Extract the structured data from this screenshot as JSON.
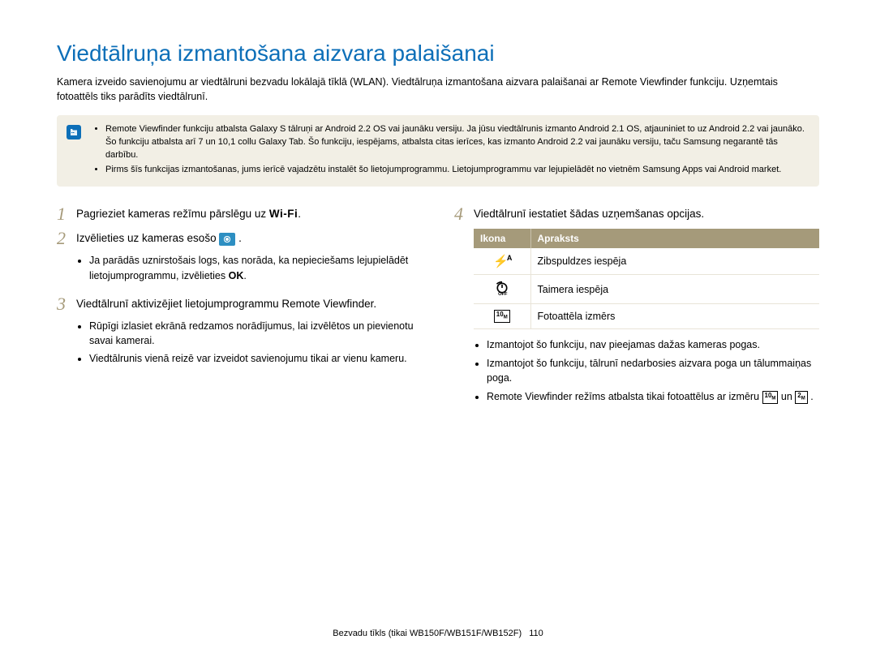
{
  "title": "Viedtālruņa izmantošana aizvara palaišanai",
  "intro": "Kamera izveido savienojumu ar viedtālruni bezvadu lokālajā tīklā (WLAN). Viedtālruņa izmantošana aizvara palaišanai ar Remote Viewfinder funkciju. Uzņemtais fotoattēls tiks parādīts viedtālrunī.",
  "note": {
    "bullet1": "Remote Viewfinder funkciju atbalsta Galaxy S tālruņi ar Android 2.2 OS vai jaunāku versiju. Ja jūsu viedtālrunis izmanto Android 2.1 OS, atjauniniet to uz Android 2.2 vai jaunāko. Šo funkciju atbalsta arī 7 un 10,1 collu Galaxy Tab. Šo funkciju, iespējams, atbalsta citas ierīces, kas izmanto Android 2.2 vai jaunāku versiju, taču Samsung negarantē tās darbību.",
    "bullet2": "Pirms šīs funkcijas izmantošanas, jums ierīcē vajadzētu instalēt šo lietojumprogrammu. Lietojumprogrammu var lejupielādēt no vietnēm Samsung Apps vai Android market."
  },
  "steps": {
    "s1": "Pagrieziet kameras režīmu pārslēgu uz ",
    "s1_wifi": "Wi-Fi",
    "s1_end": ".",
    "s2": "Izvēlieties uz kameras esošo ",
    "s2_end": " .",
    "s2_sub1_a": "Ja parādās uznirstošais logs, kas norāda, ka nepieciešams lejupielādēt lietojumprogrammu, izvēlieties ",
    "s2_sub1_ok": "OK",
    "s2_sub1_b": ".",
    "s3": "Viedtālrunī aktivizējiet lietojumprogrammu Remote Viewfinder.",
    "s3_sub1": "Rūpīgi izlasiet ekrānā redzamos norādījumus, lai izvēlētos un pievienotu savai kamerai.",
    "s3_sub2": "Viedtālrunis vienā reizē var izveidot savienojumu tikai ar vienu kameru.",
    "s4": "Viedtālrunī iestatiet šādas uzņemšanas opcijas."
  },
  "table": {
    "h1": "Ikona",
    "h2": "Apraksts",
    "r1": "Zibspuldzes iespēja",
    "r2": "Taimera iespēja",
    "r3": "Fotoattēla izmērs"
  },
  "right": {
    "b1": "Izmantojot šo funkciju, nav pieejamas dažas kameras pogas.",
    "b2": "Izmantojot šo funkciju, tālrunī nedarbosies aizvara poga un tālummaiņas poga.",
    "b3_a": "Remote Viewfinder režīms atbalsta tikai fotoattēlus ar izmēru ",
    "b3_b": " un ",
    "b3_c": " ."
  },
  "footer": {
    "text": "Bezvadu tīkls (tikai WB150F/WB151F/WB152F)",
    "page": "110"
  }
}
